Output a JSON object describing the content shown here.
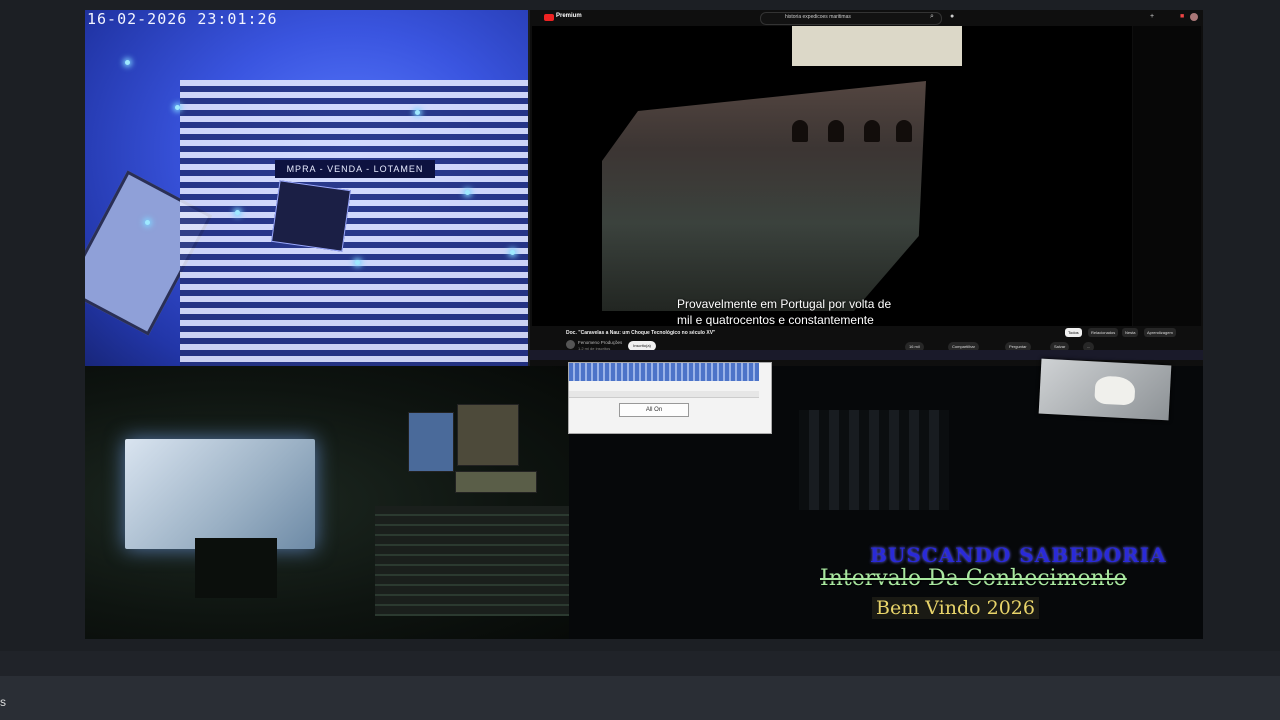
{
  "camera": {
    "timestamp": "16-02-2026  23:01:26",
    "sign": "MPRA - VENDA - LOTAMEN"
  },
  "youtube": {
    "brand": "Premium",
    "search_text": "historia expedicoes maritimas",
    "subtitle_line1": "Provavelmente em Portugal por volta de",
    "subtitle_line2": "mil e quatrocentos e constantemente",
    "video_title": "Doc. \"Caravelas a Nau: um Choque Tecnológico no século XV\"",
    "channel": "Fenomeno Produções",
    "subscribers": "1,2 mi de inscritos",
    "subscribe_label": "Inscrito(a)",
    "actions": [
      "16 mil",
      "Compartilhar",
      "Perguntar",
      "Salvar",
      "..."
    ],
    "chips": [
      "Todos",
      "Relacionados",
      "Nesta",
      "Aprendizagem"
    ],
    "accent": "#e22222"
  },
  "popup": {
    "button_label": "All On"
  },
  "overlay": {
    "line1": "BUSCANDO SABEDORIA",
    "line2": "Intervalo Da Conhecimento",
    "line3": "Bem Vindo 2026"
  },
  "taskbar": {
    "edge_text": "s"
  }
}
